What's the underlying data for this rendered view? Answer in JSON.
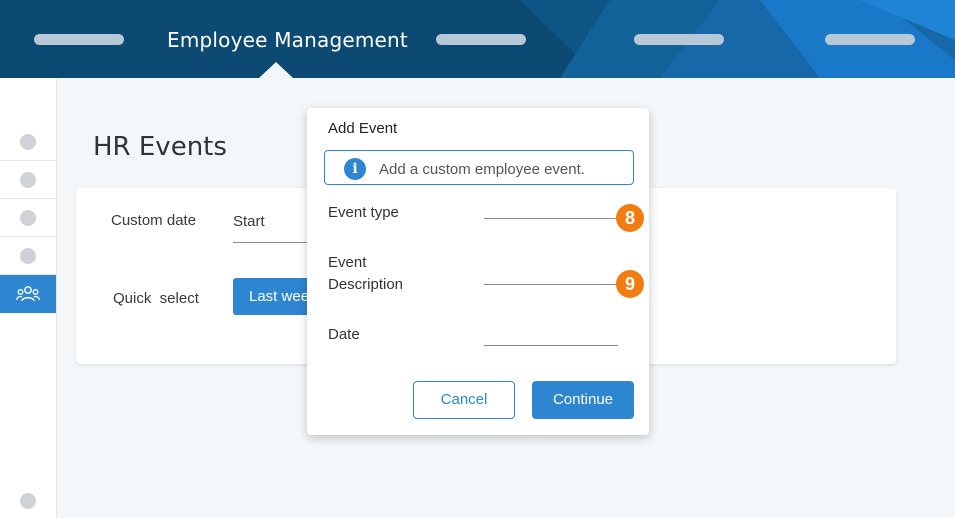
{
  "header": {
    "title": "Employee Management",
    "background_color": "#0c4a73",
    "accent_color": "#1a78c9"
  },
  "sidebar": {
    "items": [
      {
        "icon": "circle-icon",
        "active": false
      },
      {
        "icon": "circle-icon",
        "active": false
      },
      {
        "icon": "circle-icon",
        "active": false
      },
      {
        "icon": "circle-icon",
        "active": false
      },
      {
        "icon": "people-icon",
        "active": true
      },
      {
        "icon": "circle-icon",
        "active": false
      }
    ],
    "active_color": "#2d86cf"
  },
  "page": {
    "title": "HR Events",
    "custom_date_label": "Custom date",
    "start_value": "Start",
    "quick_select_label": "Quick  select",
    "quick_select_button": "Last week"
  },
  "modal": {
    "title": "Add Event",
    "info_text": "Add a custom employee event.",
    "fields": {
      "event_type": "Event type",
      "event_description_line1": "Event",
      "event_description_line2": "Description",
      "date": "Date"
    },
    "badges": {
      "event_type": "8",
      "event_description": "9"
    },
    "cancel_label": "Cancel",
    "continue_label": "Continue",
    "primary_color": "#2d86cf",
    "badge_color": "#f07c12"
  }
}
